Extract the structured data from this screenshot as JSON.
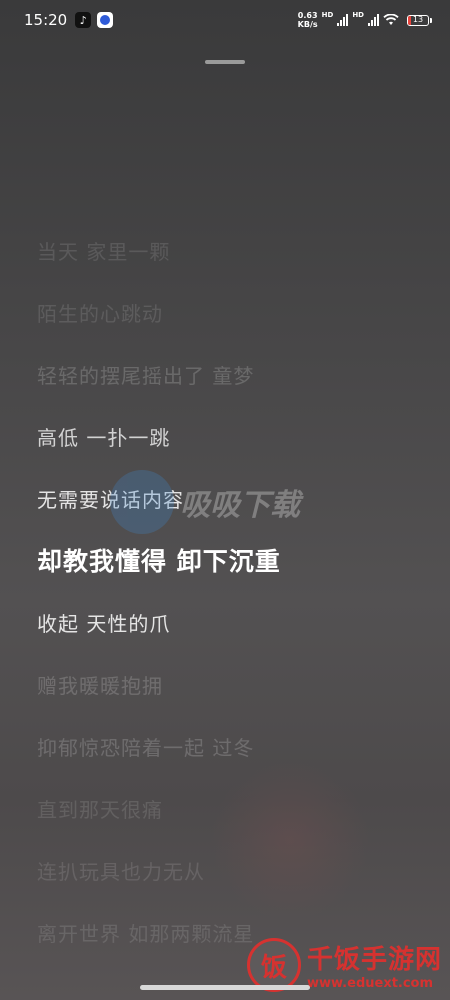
{
  "status_bar": {
    "time": "15:20",
    "net_speed_value": "0.63",
    "net_speed_unit": "KB/s",
    "hd1": "HD",
    "hd2": "HD",
    "battery_level": "13"
  },
  "lyrics": [
    "当天 家里一颗",
    "陌生的心跳动",
    "轻轻的摆尾摇出了 童梦",
    "高低 一扑一跳",
    "无需要说话内容",
    "却教我懂得 卸下沉重",
    "收起 天性的爪",
    "赠我暖暖抱拥",
    "抑郁惊恐陪着一起 过冬",
    "直到那天很痛",
    "连扒玩具也力无从",
    "离开世界 如那两颗流星"
  ],
  "current_lyric_index": 5,
  "watermark": {
    "center_text": "吸吸下载",
    "site_name": "千饭手游网",
    "site_url": "www.eduext.com",
    "seal_char": "饭"
  },
  "icons": {
    "tiktok": "tiktok-icon",
    "app": "app-circle-icon",
    "wifi": "wifi-icon",
    "battery": "battery-icon"
  },
  "colors": {
    "current_lyric": "#ffffff",
    "battery_low": "#e9443d",
    "watermark_red": "#d63230"
  }
}
